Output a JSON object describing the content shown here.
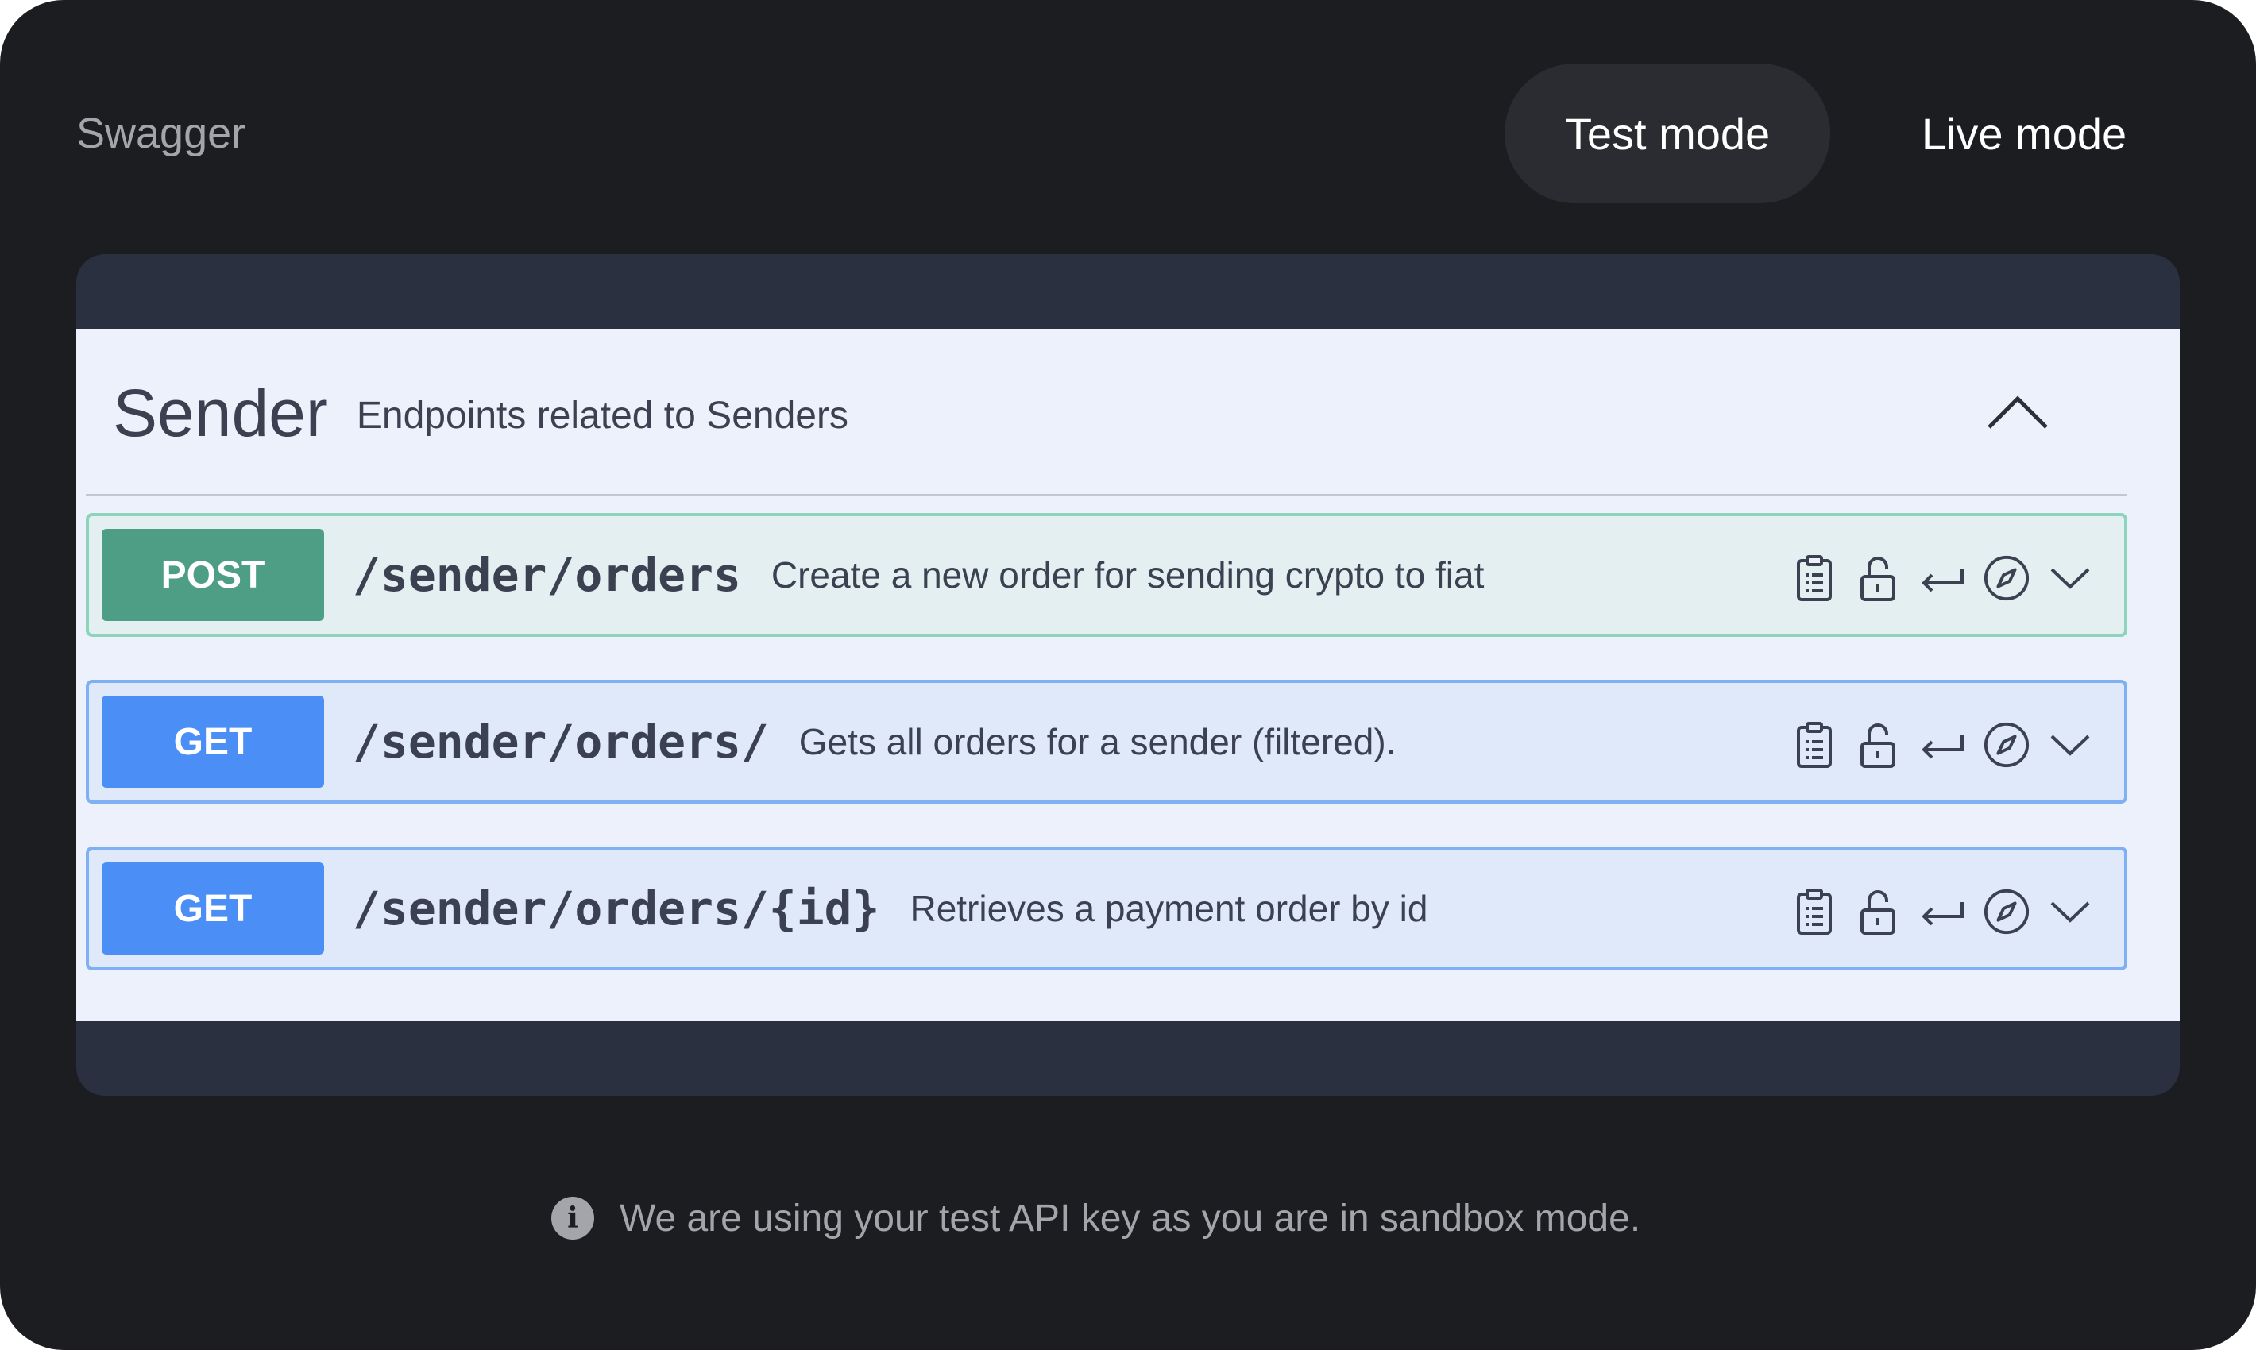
{
  "app": {
    "title": "Swagger"
  },
  "modes": {
    "test_label": "Test mode",
    "live_label": "Live mode",
    "active": "Test mode"
  },
  "tag": {
    "name": "Sender",
    "description": "Endpoints related to Senders",
    "expanded": true
  },
  "operations": [
    {
      "method": "POST",
      "path": "/sender/orders",
      "summary": "Create a new order for sending crypto to fiat"
    },
    {
      "method": "GET",
      "path": "/sender/orders/",
      "summary": "Gets all orders for a sender (filtered)."
    },
    {
      "method": "GET",
      "path": "/sender/orders/{id}",
      "summary": "Retrieves a payment order by id"
    }
  ],
  "operation_icons": [
    "clipboard-icon",
    "unlock-icon",
    "return-arrow-icon",
    "compass-icon",
    "chevron-down-icon"
  ],
  "notice": {
    "text": "We are using your test API key as you are in sandbox mode.",
    "icon": "info-icon"
  },
  "colors": {
    "background": "#1c1d21",
    "panel": "#2a3040",
    "post": "#4e9e86",
    "get": "#4b8ff6"
  }
}
